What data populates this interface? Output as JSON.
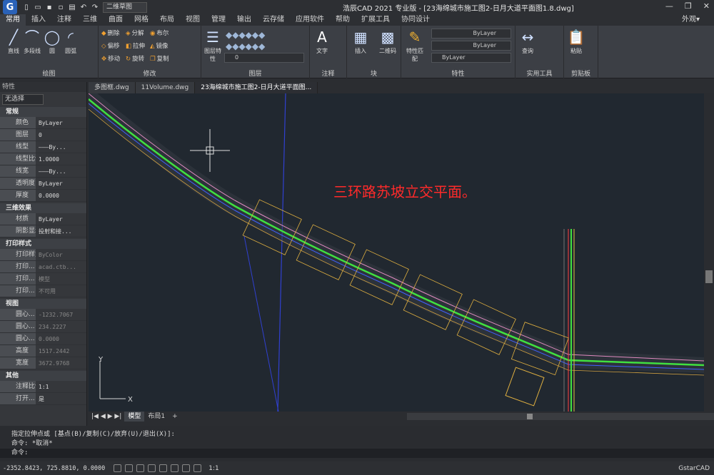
{
  "app": {
    "logo": "G",
    "workspace": "二维草图",
    "title": "浩辰CAD 2021 专业版 - [23海绵城市施工图2-日月大道平面图1.8.dwg]",
    "window_controls": [
      "minimize-icon",
      "restore-icon",
      "close-icon"
    ]
  },
  "menu": {
    "tabs": [
      "常用",
      "插入",
      "注释",
      "三维",
      "曲面",
      "网格",
      "布局",
      "视图",
      "管理",
      "输出",
      "云存储",
      "应用软件",
      "帮助",
      "扩展工具",
      "协同设计"
    ],
    "right": "外观▾"
  },
  "ribbon": {
    "draw": {
      "label": "绘图",
      "tools": [
        "直线",
        "多段线",
        "圆",
        "圆弧"
      ]
    },
    "modify": {
      "label": "修改",
      "tools": [
        "删除",
        "分解",
        "布尔",
        "偏移",
        "拉伸",
        "镜像",
        "移动",
        "旋转",
        "复制"
      ]
    },
    "layer": {
      "label": "图层",
      "tool": "图层特性",
      "current": "0"
    },
    "annotation": {
      "label": "注释",
      "tool": "文字"
    },
    "block": {
      "label": "块",
      "tools": [
        "插入",
        "二维码"
      ]
    },
    "properties": {
      "label": "特性",
      "tool": "特性匹配",
      "color": "ByLayer",
      "linetype": "ByLayer",
      "lineweight": "ByLayer"
    },
    "utilities": {
      "label": "实用工具",
      "tool": "查询"
    },
    "clipboard": {
      "label": "剪贴板",
      "tool": "粘贴"
    }
  },
  "doc_tabs": [
    "多图框.dwg",
    "11Volume.dwg",
    "23海绵城市施工图2-日月大道平面图..."
  ],
  "props_panel": {
    "title": "特性",
    "selection": "无选择",
    "sections": [
      {
        "name": "常规",
        "rows": [
          [
            "颜色",
            "ByLayer"
          ],
          [
            "图层",
            "0"
          ],
          [
            "线型",
            "———By..."
          ],
          [
            "线型比例",
            "1.0000"
          ],
          [
            "线宽",
            "———By..."
          ],
          [
            "透明度",
            "ByLayer"
          ],
          [
            "厚度",
            "0.0000"
          ]
        ]
      },
      {
        "name": "三维效果",
        "rows": [
          [
            "材质",
            "ByLayer"
          ],
          [
            "阴影显示",
            "投射和接..."
          ]
        ]
      },
      {
        "name": "打印样式",
        "rows": [
          [
            "打印样式",
            "ByColor"
          ],
          [
            "打印...",
            "acad.ctb..."
          ],
          [
            "打印...",
            "模型"
          ],
          [
            "打印...",
            "不可用"
          ]
        ]
      },
      {
        "name": "视图",
        "rows": [
          [
            "圆心...",
            "-1232.7067"
          ],
          [
            "圆心...",
            "234.2227"
          ],
          [
            "圆心...",
            "0.0000"
          ],
          [
            "高度",
            "1517.2442"
          ],
          [
            "宽度",
            "3672.9768"
          ]
        ]
      },
      {
        "name": "其他",
        "rows": [
          [
            "注释比例",
            "1:1"
          ],
          [
            "打开...",
            "是"
          ]
        ]
      }
    ]
  },
  "canvas": {
    "annotation": "三环路苏坡立交平面。",
    "annotation_color": "#ff2a2a",
    "axis_y": "Y",
    "axis_x": "X"
  },
  "layout_tabs": [
    "模型",
    "布局1",
    "+"
  ],
  "command": {
    "lines": [
      "指定拉伸点或 [基点(B)/复制(C)/放弃(U)/退出(X)]:",
      "命令: *取消*"
    ],
    "prompt": "命令:"
  },
  "status": {
    "coords": "-2352.8423, 725.8810, 0.0000",
    "scale": "1:1",
    "brand": "GstarCAD"
  }
}
